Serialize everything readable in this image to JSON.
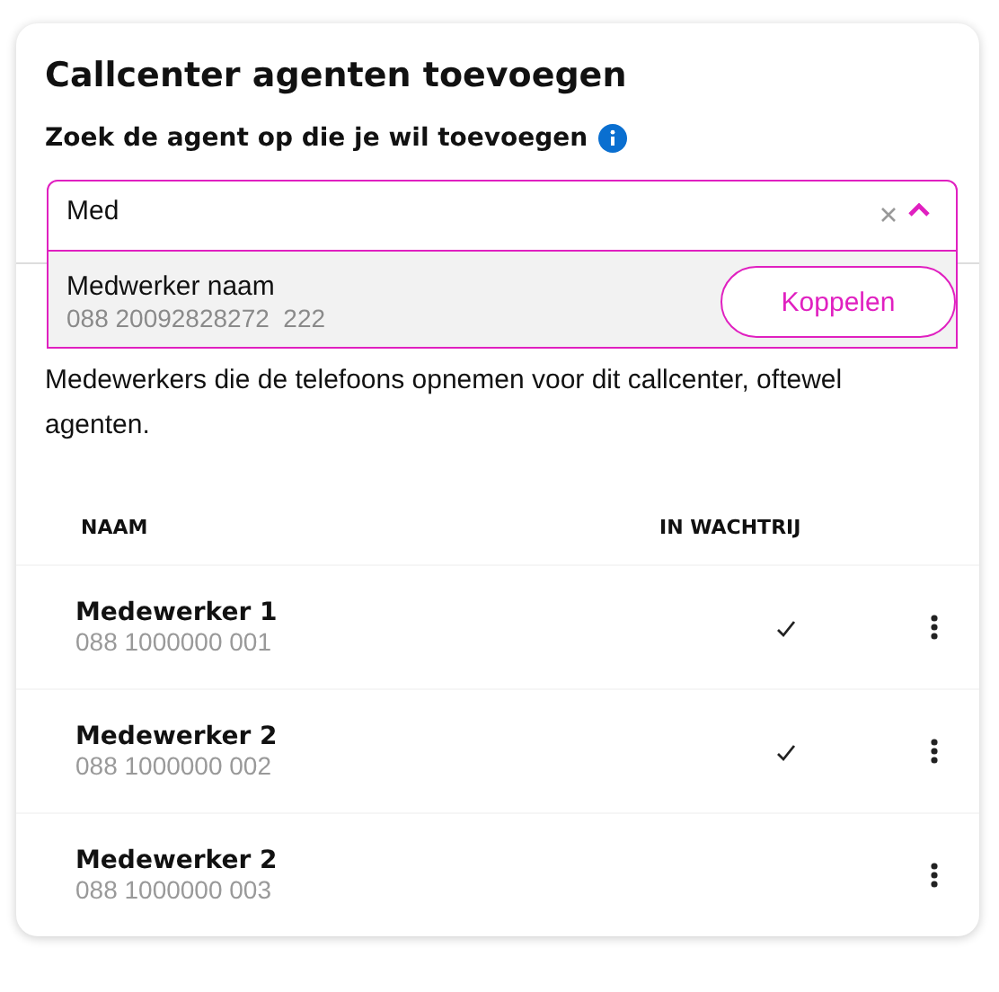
{
  "title": "Callcenter agenten toevoegen",
  "search": {
    "label": "Zoek de agent op die je wil toevoegen",
    "value": "Med",
    "expanded": true,
    "results": [
      {
        "name": "Medwerker naam",
        "number": "088 20092828272  222",
        "action": "Koppelen"
      }
    ]
  },
  "description": "Medewerkers die de telefoons opnemen voor dit callcenter, oftewel agenten.",
  "table": {
    "columns": [
      "NAAM",
      "IN WACHTRIJ"
    ],
    "rows": [
      {
        "name": "Medewerker 1",
        "number": "088 1000000 001",
        "in_queue": true
      },
      {
        "name": "Medewerker 2",
        "number": "088 1000000 002",
        "in_queue": true
      },
      {
        "name": "Medewerker 2",
        "number": "088 1000000 003",
        "in_queue": false
      }
    ]
  }
}
